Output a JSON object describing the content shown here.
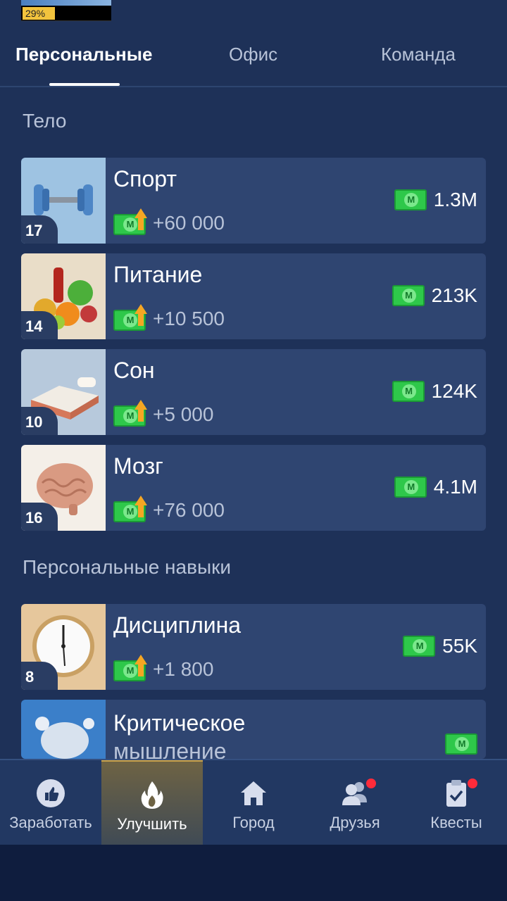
{
  "header": {
    "progress_percent": "29%"
  },
  "tabs": [
    {
      "label": "Персональные",
      "active": true
    },
    {
      "label": "Офис",
      "active": false
    },
    {
      "label": "Команда",
      "active": false
    }
  ],
  "sections": {
    "body_title": "Тело",
    "skills_title": "Персональные навыки"
  },
  "cards": [
    {
      "title": "Спорт",
      "level": "17",
      "income": "+60 000",
      "price": "1.3M"
    },
    {
      "title": "Питание",
      "level": "14",
      "income": "+10 500",
      "price": "213K"
    },
    {
      "title": "Сон",
      "level": "10",
      "income": "+5 000",
      "price": "124K"
    },
    {
      "title": "Мозг",
      "level": "16",
      "income": "+76 000",
      "price": "4.1M"
    },
    {
      "title": "Дисциплина",
      "level": "8",
      "income": "+1 800",
      "price": "55K"
    },
    {
      "title": "Критическое",
      "subtitle": "мышление"
    }
  ],
  "bottom_nav": [
    {
      "label": "Заработать",
      "icon": "thumbs-up-icon",
      "active": false
    },
    {
      "label": "Улучшить",
      "icon": "fire-icon",
      "active": true
    },
    {
      "label": "Город",
      "icon": "home-icon",
      "active": false
    },
    {
      "label": "Друзья",
      "icon": "friends-icon",
      "active": false,
      "badge": true
    },
    {
      "label": "Квесты",
      "icon": "clipboard-icon",
      "active": false,
      "badge": true
    }
  ],
  "colors": {
    "background": "#1e3158",
    "card": "#2f4571",
    "money": "#2ec84a",
    "accent": "#f5a623"
  }
}
